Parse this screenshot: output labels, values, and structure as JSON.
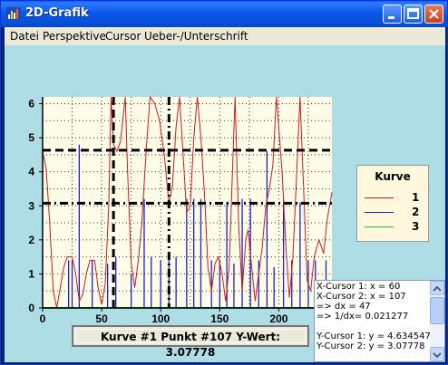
{
  "window": {
    "title": "2D-Grafik"
  },
  "menu": [
    "Datei",
    "Perspektive",
    "Cursor",
    "Ueber-/Unterschrift"
  ],
  "chart_data": {
    "type": "line",
    "xlim": [
      0,
      245
    ],
    "ylim": [
      0,
      6.2
    ],
    "x_ticks": [
      "0",
      "50",
      "100",
      "150",
      "200"
    ],
    "y_ticks": [
      "0",
      "1",
      "2",
      "3",
      "4",
      "5",
      "6"
    ],
    "grid": true,
    "legend": {
      "title": "Kurve",
      "position": "right",
      "entries": [
        "1",
        "2",
        "3"
      ]
    },
    "series": [
      {
        "name": "1",
        "color": "#C81E1E",
        "points": [
          [
            0,
            4.6
          ],
          [
            3,
            4.1
          ],
          [
            6,
            2.5
          ],
          [
            9,
            0.5
          ],
          [
            12,
            0.0
          ],
          [
            15,
            0.6
          ],
          [
            18,
            1.2
          ],
          [
            21,
            1.5
          ],
          [
            25,
            1.5
          ],
          [
            28,
            1.0
          ],
          [
            31,
            0.2
          ],
          [
            34,
            0.4
          ],
          [
            37,
            1.0
          ],
          [
            40,
            1.4
          ],
          [
            44,
            1.4
          ],
          [
            47,
            0.6
          ],
          [
            50,
            0.1
          ],
          [
            53,
            0.7
          ],
          [
            56,
            3.0
          ],
          [
            58,
            6.2
          ],
          [
            60,
            4.8
          ],
          [
            63,
            4.6
          ],
          [
            66,
            4.9
          ],
          [
            70,
            6.2
          ],
          [
            72,
            4.0
          ],
          [
            75,
            1.3
          ],
          [
            78,
            0.6
          ],
          [
            81,
            1.4
          ],
          [
            84,
            2.5
          ],
          [
            88,
            4.8
          ],
          [
            91,
            6.2
          ],
          [
            95,
            6.0
          ],
          [
            99,
            5.5
          ],
          [
            103,
            4.5
          ],
          [
            107,
            3.08
          ],
          [
            110,
            3.6
          ],
          [
            113,
            5.3
          ],
          [
            116,
            6.2
          ],
          [
            119,
            4.5
          ],
          [
            122,
            2.8
          ],
          [
            125,
            3.0
          ],
          [
            128,
            5.0
          ],
          [
            131,
            6.2
          ],
          [
            134,
            5.0
          ],
          [
            137,
            3.4
          ],
          [
            140,
            1.2
          ],
          [
            143,
            0.5
          ],
          [
            146,
            1.3
          ],
          [
            149,
            1.5
          ],
          [
            152,
            1.0
          ],
          [
            155,
            0.2
          ],
          [
            158,
            1.2
          ],
          [
            161,
            4.2
          ],
          [
            163,
            6.2
          ],
          [
            166,
            2.5
          ],
          [
            169,
            0.5
          ],
          [
            172,
            2.0
          ],
          [
            174,
            2.3
          ],
          [
            177,
            1.2
          ],
          [
            180,
            0.2
          ],
          [
            183,
            1.0
          ],
          [
            186,
            1.8
          ],
          [
            189,
            3.0
          ],
          [
            192,
            3.5
          ],
          [
            195,
            4.2
          ],
          [
            198,
            6.2
          ],
          [
            200,
            5.3
          ],
          [
            203,
            3.9
          ],
          [
            206,
            1.8
          ],
          [
            209,
            0.3
          ],
          [
            212,
            1.5
          ],
          [
            215,
            3.8
          ],
          [
            218,
            6.2
          ],
          [
            221,
            3.5
          ],
          [
            224,
            0.8
          ],
          [
            227,
            0.5
          ],
          [
            230,
            1.5
          ],
          [
            234,
            2.0
          ],
          [
            238,
            1.6
          ],
          [
            241,
            2.6
          ],
          [
            245,
            3.4
          ]
        ]
      },
      {
        "name": "2",
        "color": "#1E1EC8",
        "spikes": [
          [
            22,
            1.4
          ],
          [
            25,
            1.4
          ],
          [
            31,
            4.8
          ],
          [
            42,
            1.4
          ],
          [
            55,
            1.3
          ],
          [
            62,
            1.5
          ],
          [
            75,
            1.0
          ],
          [
            86,
            3.2
          ],
          [
            92,
            1.5
          ],
          [
            100,
            1.4
          ],
          [
            107,
            1.5
          ],
          [
            113,
            1.5
          ],
          [
            122,
            3.2
          ],
          [
            128,
            3.2
          ],
          [
            134,
            3.2
          ],
          [
            143,
            1.4
          ],
          [
            150,
            1.4
          ],
          [
            156,
            3.1
          ],
          [
            162,
            1.3
          ],
          [
            169,
            3.2
          ],
          [
            176,
            3.2
          ],
          [
            183,
            1.4
          ],
          [
            190,
            4.6
          ],
          [
            196,
            1.2
          ],
          [
            204,
            3.2
          ],
          [
            211,
            1.4
          ],
          [
            218,
            3.1
          ],
          [
            225,
            1.4
          ],
          [
            231,
            1.4
          ],
          [
            240,
            1.4
          ]
        ]
      },
      {
        "name": "3",
        "color": "#22C822",
        "values": [
          0.0
        ]
      }
    ],
    "cursors": {
      "x": [
        60,
        107
      ],
      "y": [
        4.634547,
        3.07778
      ]
    }
  },
  "status": {
    "text": "Kurve #1   Punkt #107 Y-Wert: 3.07778"
  },
  "cursor_info": {
    "lines": [
      "X-Cursor 1: x = 60",
      "X-Cursor 2: x = 107",
      "=> dx = 47",
      "=> 1/dx= 0.021277",
      "",
      "Y-Cursor 1: y = 4.634547",
      "Y-Cursor 2: y = 3.07778"
    ]
  }
}
